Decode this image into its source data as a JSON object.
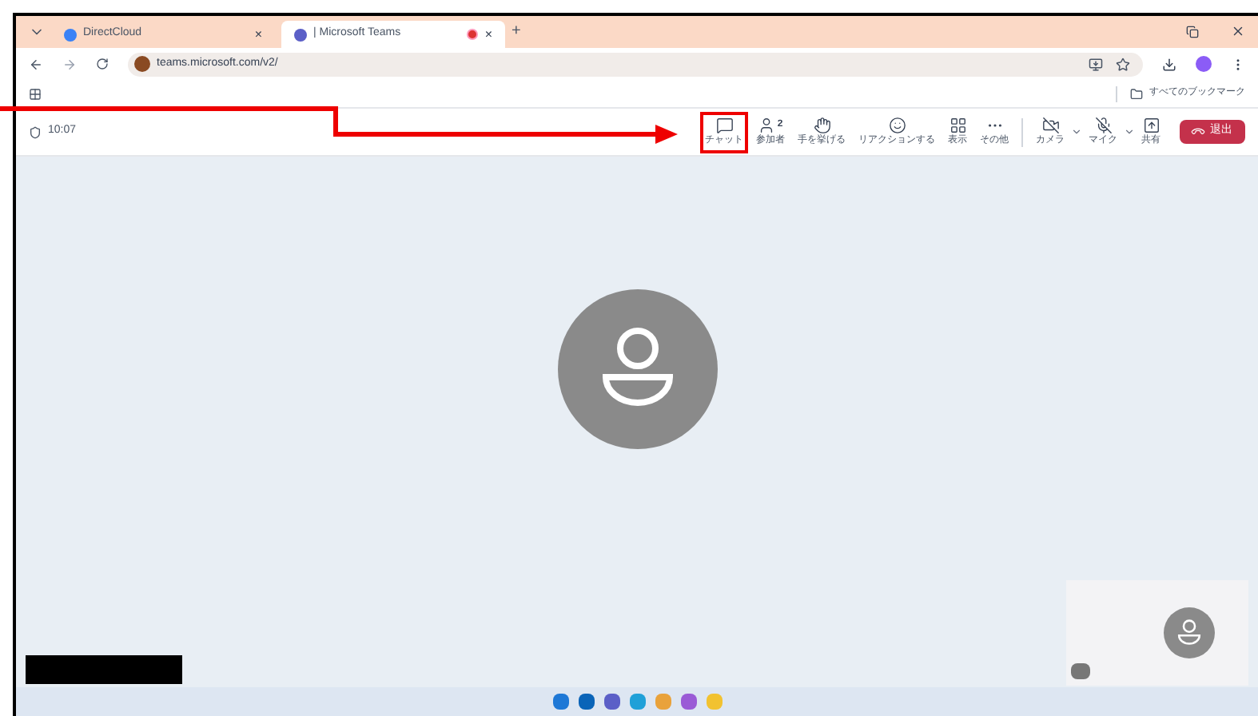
{
  "browser": {
    "tabs": [
      {
        "title": "DirectCloud",
        "selected": false,
        "close": "×"
      },
      {
        "title": "| Microsoft Teams",
        "selected": true,
        "close": "×"
      }
    ],
    "new_tab": "+",
    "address": "teams.microsoft.com/v2/",
    "bookmarks_folder": "すべてのブックマーク"
  },
  "meeting": {
    "time": "10:07",
    "tools": [
      {
        "kind": "chat",
        "label": "チャット",
        "highlighted": true
      },
      {
        "kind": "people",
        "label": "参加者",
        "count": "2",
        "highlighted": false
      },
      {
        "kind": "hand",
        "label": "手を挙げる",
        "highlighted": false
      },
      {
        "kind": "react",
        "label": "リアクションする",
        "highlighted": false
      },
      {
        "kind": "view",
        "label": "表示",
        "highlighted": false
      },
      {
        "kind": "more",
        "label": "その他",
        "highlighted": false
      },
      {
        "kind": "camera",
        "label": "カメラ",
        "highlighted": false
      },
      {
        "kind": "mic",
        "label": "マイク",
        "highlighted": false
      },
      {
        "kind": "share",
        "label": "共有",
        "highlighted": false
      }
    ],
    "leave": "退出"
  }
}
